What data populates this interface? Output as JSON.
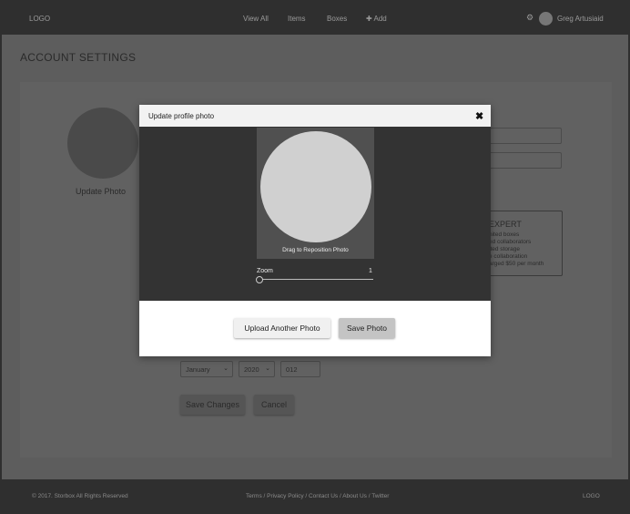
{
  "header": {
    "logo": "LOGO",
    "nav": [
      "View All",
      "Items",
      "Boxes",
      "Add"
    ],
    "add_icon": "plus-icon",
    "settings_icon": "gear-icon",
    "user_name": "Greg Artusiaid"
  },
  "page": {
    "title": "ACCOUNT SETTINGS",
    "update_photo_link": "Update Photo",
    "plan": {
      "title": "EXPERT",
      "features": [
        "nited boxes",
        "ed collaborators",
        "ited storage",
        "e collaboration",
        "arged $50 per month"
      ]
    },
    "billing": {
      "month": "January",
      "year": "2020",
      "cvc": "012"
    },
    "save_changes": "Save Changes",
    "cancel": "Cancel"
  },
  "modal": {
    "title": "Update profile photo",
    "close_icon": "close-icon",
    "drag_hint": "Drag to Reposition Photo",
    "zoom_label": "Zoom",
    "zoom_value": "1",
    "zoom_level": 0,
    "upload_button": "Upload Another Photo",
    "save_button": "Save Photo"
  },
  "footer": {
    "copyright": "© 2017. Storbox All Rights Reserved",
    "links": "Terms / Privacy Policy / Contact Us / About Us / Twitter",
    "logo": "LOGO"
  }
}
